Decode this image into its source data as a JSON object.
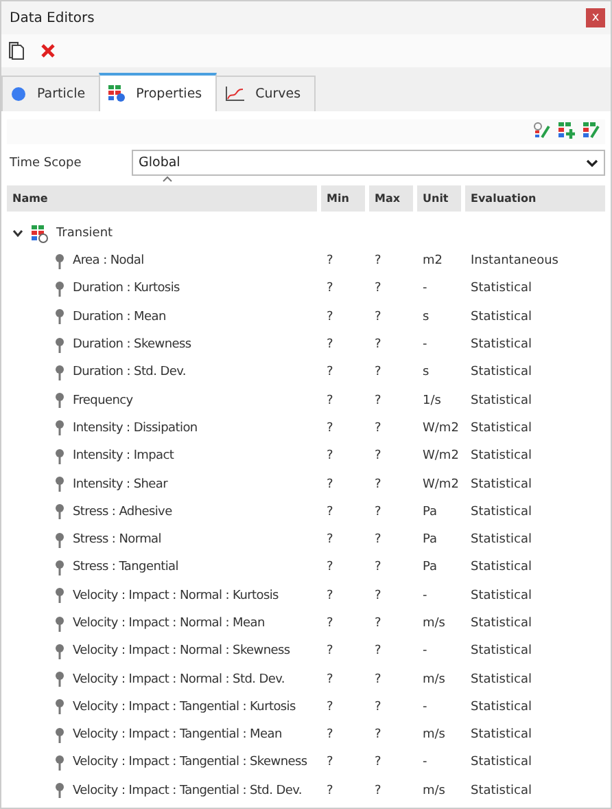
{
  "window": {
    "title": "Data Editors",
    "close": "x"
  },
  "tabs": [
    {
      "label": "Particle",
      "kind": "particle",
      "selected": false
    },
    {
      "label": "Properties",
      "kind": "properties",
      "selected": true
    },
    {
      "label": "Curves",
      "kind": "curves",
      "selected": false
    }
  ],
  "time_scope": {
    "label": "Time Scope",
    "value": "Global"
  },
  "table": {
    "columns": [
      "Name",
      "Min",
      "Max",
      "Unit",
      "Evaluation"
    ],
    "tree": [
      {
        "name": "Transient",
        "expanded": true,
        "children": [
          {
            "name": "Area : Nodal",
            "min": "?",
            "max": "?",
            "unit": "m2",
            "evaluation": "Instantaneous"
          },
          {
            "name": "Duration : Kurtosis",
            "min": "?",
            "max": "?",
            "unit": "-",
            "evaluation": "Statistical"
          },
          {
            "name": "Duration : Mean",
            "min": "?",
            "max": "?",
            "unit": "s",
            "evaluation": "Statistical"
          },
          {
            "name": "Duration : Skewness",
            "min": "?",
            "max": "?",
            "unit": "-",
            "evaluation": "Statistical"
          },
          {
            "name": "Duration : Std. Dev.",
            "min": "?",
            "max": "?",
            "unit": "s",
            "evaluation": "Statistical"
          },
          {
            "name": "Frequency",
            "min": "?",
            "max": "?",
            "unit": "1/s",
            "evaluation": "Statistical"
          },
          {
            "name": "Intensity : Dissipation",
            "min": "?",
            "max": "?",
            "unit": "W/m2",
            "evaluation": "Statistical"
          },
          {
            "name": "Intensity : Impact",
            "min": "?",
            "max": "?",
            "unit": "W/m2",
            "evaluation": "Statistical"
          },
          {
            "name": "Intensity : Shear",
            "min": "?",
            "max": "?",
            "unit": "W/m2",
            "evaluation": "Statistical"
          },
          {
            "name": "Stress : Adhesive",
            "min": "?",
            "max": "?",
            "unit": "Pa",
            "evaluation": "Statistical"
          },
          {
            "name": "Stress : Normal",
            "min": "?",
            "max": "?",
            "unit": "Pa",
            "evaluation": "Statistical"
          },
          {
            "name": "Stress : Tangential",
            "min": "?",
            "max": "?",
            "unit": "Pa",
            "evaluation": "Statistical"
          },
          {
            "name": "Velocity : Impact : Normal : Kurtosis",
            "min": "?",
            "max": "?",
            "unit": "-",
            "evaluation": "Statistical"
          },
          {
            "name": "Velocity : Impact : Normal : Mean",
            "min": "?",
            "max": "?",
            "unit": "m/s",
            "evaluation": "Statistical"
          },
          {
            "name": "Velocity : Impact : Normal : Skewness",
            "min": "?",
            "max": "?",
            "unit": "-",
            "evaluation": "Statistical"
          },
          {
            "name": "Velocity : Impact : Normal : Std. Dev.",
            "min": "?",
            "max": "?",
            "unit": "m/s",
            "evaluation": "Statistical"
          },
          {
            "name": "Velocity : Impact : Tangential : Kurtosis",
            "min": "?",
            "max": "?",
            "unit": "-",
            "evaluation": "Statistical"
          },
          {
            "name": "Velocity : Impact : Tangential : Mean",
            "min": "?",
            "max": "?",
            "unit": "m/s",
            "evaluation": "Statistical"
          },
          {
            "name": "Velocity : Impact : Tangential : Skewness",
            "min": "?",
            "max": "?",
            "unit": "-",
            "evaluation": "Statistical"
          },
          {
            "name": "Velocity : Impact : Tangential : Std. Dev.",
            "min": "?",
            "max": "?",
            "unit": "m/s",
            "evaluation": "Statistical"
          }
        ]
      }
    ]
  }
}
